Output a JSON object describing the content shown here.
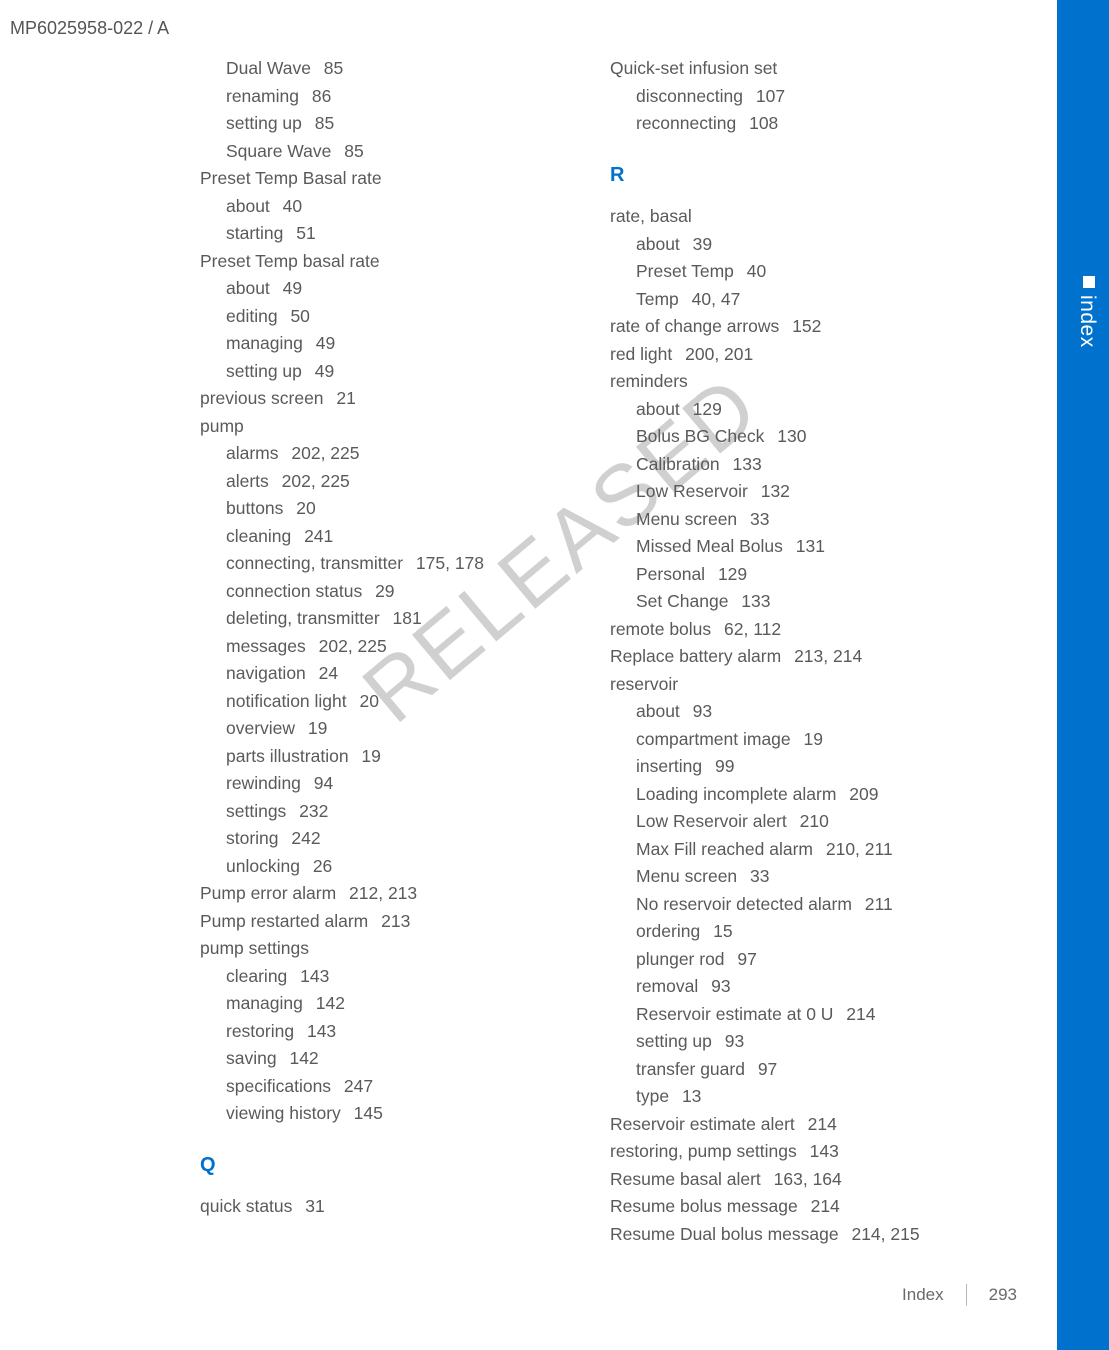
{
  "header": "MP6025958-022 / A",
  "watermark": "RELEASED",
  "sideTab": "index",
  "footer": {
    "label": "Index",
    "page": "293"
  },
  "col1": [
    {
      "t": "Dual Wave",
      "p": "85",
      "s": true
    },
    {
      "t": "renaming",
      "p": "86",
      "s": true
    },
    {
      "t": "setting up",
      "p": "85",
      "s": true
    },
    {
      "t": "Square Wave",
      "p": "85",
      "s": true
    },
    {
      "t": "Preset Temp Basal rate",
      "p": "",
      "s": false
    },
    {
      "t": "about",
      "p": "40",
      "s": true
    },
    {
      "t": "starting",
      "p": "51",
      "s": true
    },
    {
      "t": "Preset Temp basal rate",
      "p": "",
      "s": false
    },
    {
      "t": "about",
      "p": "49",
      "s": true
    },
    {
      "t": "editing",
      "p": "50",
      "s": true
    },
    {
      "t": "managing",
      "p": "49",
      "s": true
    },
    {
      "t": "setting up",
      "p": "49",
      "s": true
    },
    {
      "t": "previous screen",
      "p": "21",
      "s": false
    },
    {
      "t": "pump",
      "p": "",
      "s": false
    },
    {
      "t": "alarms",
      "p": "202, 225",
      "s": true
    },
    {
      "t": "alerts",
      "p": "202, 225",
      "s": true
    },
    {
      "t": "buttons",
      "p": "20",
      "s": true
    },
    {
      "t": "cleaning",
      "p": "241",
      "s": true
    },
    {
      "t": "connecting, transmitter",
      "p": "175, 178",
      "s": true
    },
    {
      "t": "connection status",
      "p": "29",
      "s": true
    },
    {
      "t": "deleting, transmitter",
      "p": "181",
      "s": true
    },
    {
      "t": "messages",
      "p": "202, 225",
      "s": true
    },
    {
      "t": "navigation",
      "p": "24",
      "s": true
    },
    {
      "t": "notification light",
      "p": "20",
      "s": true
    },
    {
      "t": "overview",
      "p": "19",
      "s": true
    },
    {
      "t": "parts illustration",
      "p": "19",
      "s": true
    },
    {
      "t": "rewinding",
      "p": "94",
      "s": true
    },
    {
      "t": "settings",
      "p": "232",
      "s": true
    },
    {
      "t": "storing",
      "p": "242",
      "s": true
    },
    {
      "t": "unlocking",
      "p": "26",
      "s": true
    },
    {
      "t": "Pump error alarm",
      "p": "212, 213",
      "s": false
    },
    {
      "t": "Pump restarted alarm",
      "p": "213",
      "s": false
    },
    {
      "t": "pump settings",
      "p": "",
      "s": false
    },
    {
      "t": "clearing",
      "p": "143",
      "s": true
    },
    {
      "t": "managing",
      "p": "142",
      "s": true
    },
    {
      "t": "restoring",
      "p": "143",
      "s": true
    },
    {
      "t": "saving",
      "p": "142",
      "s": true
    },
    {
      "t": "specifications",
      "p": "247",
      "s": true
    },
    {
      "t": "viewing history",
      "p": "145",
      "s": true
    },
    {
      "letter": "Q"
    },
    {
      "t": "quick status",
      "p": "31",
      "s": false
    }
  ],
  "col2": [
    {
      "t": "Quick-set infusion set",
      "p": "",
      "s": false
    },
    {
      "t": "disconnecting",
      "p": "107",
      "s": true
    },
    {
      "t": "reconnecting",
      "p": "108",
      "s": true
    },
    {
      "letter": "R"
    },
    {
      "t": "rate, basal",
      "p": "",
      "s": false
    },
    {
      "t": "about",
      "p": "39",
      "s": true
    },
    {
      "t": "Preset Temp",
      "p": "40",
      "s": true
    },
    {
      "t": "Temp",
      "p": "40, 47",
      "s": true
    },
    {
      "t": "rate of change arrows",
      "p": "152",
      "s": false
    },
    {
      "t": "red light",
      "p": "200, 201",
      "s": false
    },
    {
      "t": "reminders",
      "p": "",
      "s": false
    },
    {
      "t": "about",
      "p": "129",
      "s": true
    },
    {
      "t": "Bolus BG Check",
      "p": "130",
      "s": true
    },
    {
      "t": "Calibration",
      "p": "133",
      "s": true
    },
    {
      "t": "Low Reservoir",
      "p": "132",
      "s": true
    },
    {
      "t": "Menu screen",
      "p": "33",
      "s": true
    },
    {
      "t": "Missed Meal Bolus",
      "p": "131",
      "s": true
    },
    {
      "t": "Personal",
      "p": "129",
      "s": true
    },
    {
      "t": "Set Change",
      "p": "133",
      "s": true
    },
    {
      "t": "remote bolus",
      "p": "62, 112",
      "s": false
    },
    {
      "t": "Replace battery alarm",
      "p": "213, 214",
      "s": false
    },
    {
      "t": "reservoir",
      "p": "",
      "s": false
    },
    {
      "t": "about",
      "p": "93",
      "s": true
    },
    {
      "t": "compartment image",
      "p": "19",
      "s": true
    },
    {
      "t": "inserting",
      "p": "99",
      "s": true
    },
    {
      "t": "Loading incomplete alarm",
      "p": "209",
      "s": true
    },
    {
      "t": "Low Reservoir alert",
      "p": "210",
      "s": true
    },
    {
      "t": "Max Fill reached alarm",
      "p": "210, 211",
      "s": true
    },
    {
      "t": "Menu screen",
      "p": "33",
      "s": true
    },
    {
      "t": "No reservoir detected alarm",
      "p": "211",
      "s": true
    },
    {
      "t": "ordering",
      "p": "15",
      "s": true
    },
    {
      "t": "plunger rod",
      "p": "97",
      "s": true
    },
    {
      "t": "removal",
      "p": "93",
      "s": true
    },
    {
      "t": "Reservoir estimate at 0 U",
      "p": "214",
      "s": true
    },
    {
      "t": "setting up",
      "p": "93",
      "s": true
    },
    {
      "t": "transfer guard",
      "p": "97",
      "s": true
    },
    {
      "t": "type",
      "p": "13",
      "s": true
    },
    {
      "t": "Reservoir estimate alert",
      "p": "214",
      "s": false
    },
    {
      "t": "restoring, pump settings",
      "p": "143",
      "s": false
    },
    {
      "t": "Resume basal alert",
      "p": "163, 164",
      "s": false
    },
    {
      "t": "Resume bolus message",
      "p": "214",
      "s": false
    },
    {
      "t": "Resume Dual bolus message",
      "p": "214, 215",
      "s": false
    }
  ]
}
